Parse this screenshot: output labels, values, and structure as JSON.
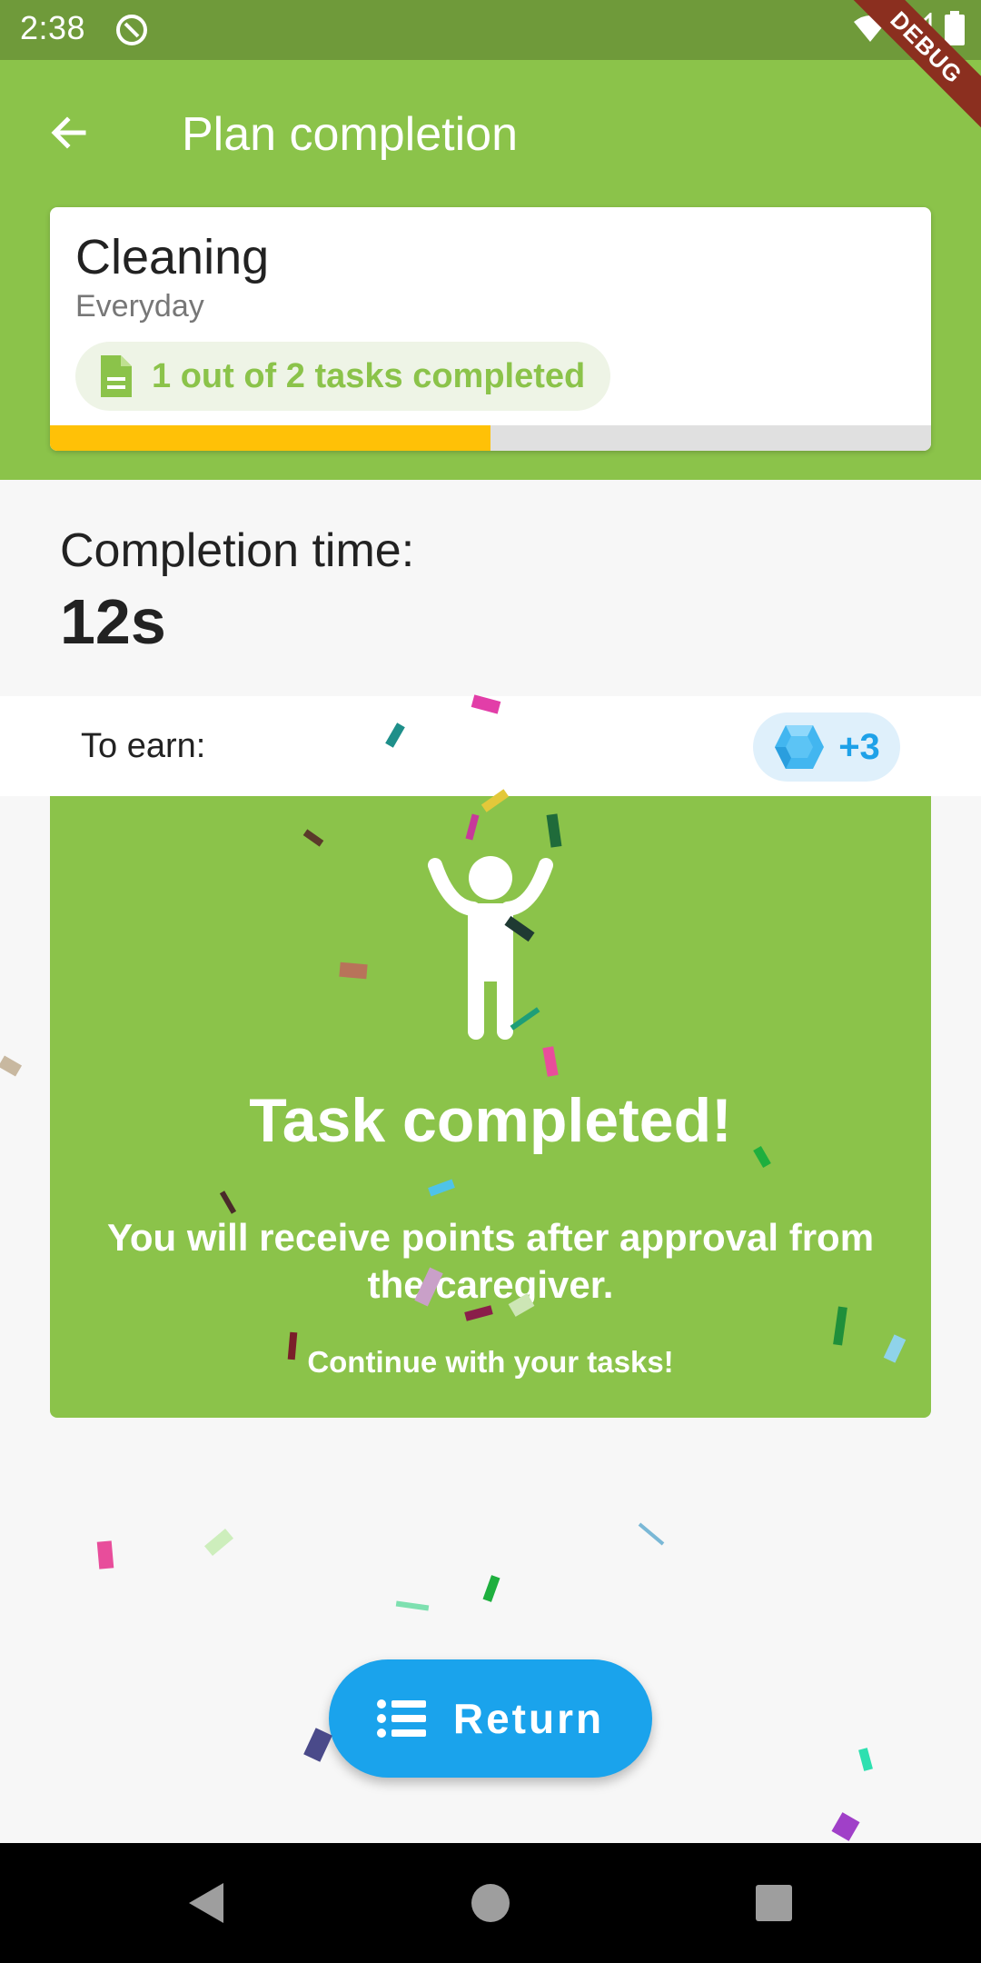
{
  "status_bar": {
    "time": "2:38",
    "icons": [
      "app-notification-icon",
      "wifi-icon",
      "cellular-signal-icon",
      "battery-icon"
    ]
  },
  "debug_banner": "DEBUG",
  "app_bar": {
    "title": "Plan completion",
    "back_icon": "arrow-back-icon"
  },
  "plan": {
    "title": "Cleaning",
    "frequency": "Everyday",
    "tasks_summary": "1 out of 2 tasks completed",
    "tasks_icon": "document-icon",
    "progress": 0.5,
    "colors": {
      "progress": "#ffc107",
      "track": "#e0e0e0"
    }
  },
  "completion": {
    "label": "Completion time:",
    "value": "12s"
  },
  "earn": {
    "label": "To earn:",
    "points": "+3",
    "icon": "gem-icon"
  },
  "success": {
    "figure_icon": "celebrating-person-icon",
    "title": "Task completed!",
    "message": "You will receive points after approval from the caregiver.",
    "footer": "Continue with your tasks!"
  },
  "return_button": {
    "label": "Return",
    "icon": "list-icon"
  },
  "nav_bar": {
    "buttons": [
      "back-triangle-icon",
      "home-circle-icon",
      "recents-square-icon"
    ]
  },
  "colors": {
    "primary": "#8bc34a",
    "status_bar": "#6f9a3a",
    "accent": "#1aa3ec",
    "background": "#f7f7f7"
  }
}
